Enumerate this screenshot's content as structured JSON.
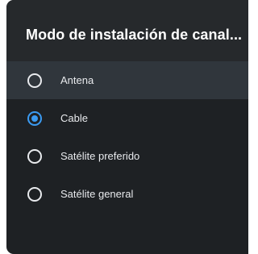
{
  "dialog": {
    "title": "Modo de instalación de canal...",
    "options": [
      {
        "label": "Antena",
        "selected": false,
        "focused": true
      },
      {
        "label": "Cable",
        "selected": true,
        "focused": false
      },
      {
        "label": "Satélite preferido",
        "selected": false,
        "focused": false
      },
      {
        "label": "Satélite general",
        "selected": false,
        "focused": false
      }
    ]
  },
  "colors": {
    "panel_background": "#1e2124",
    "header_background": "#26292c",
    "focus_highlight": "#30363c",
    "accent": "#3b9bf2",
    "text": "#e8eaed"
  },
  "icons": {
    "unselected_radio": "radio-unchecked-icon",
    "selected_radio": "radio-checked-icon"
  }
}
